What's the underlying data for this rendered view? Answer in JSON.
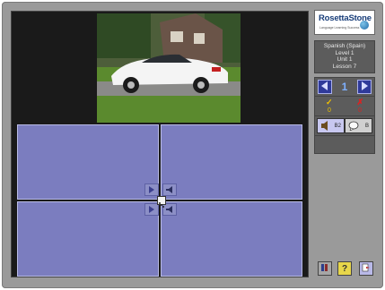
{
  "brand": {
    "name": "RosettaStone",
    "tagline": "Language Learning Success"
  },
  "lesson_info": {
    "language": "Spanish (Spain)",
    "level": "Level 1",
    "unit": "Unit 1",
    "lesson": "Lesson 7"
  },
  "navigation": {
    "current": "1"
  },
  "score": {
    "correct": "0",
    "incorrect": "0"
  },
  "modes": [
    {
      "label": "B2",
      "icon": "speaker-icon",
      "selected": true
    },
    {
      "label": "B",
      "icon": "speech-bubble-icon",
      "selected": false
    }
  ],
  "colors": {
    "answer_panel": "#7b7dbf",
    "nav_button": "#2f3a9a",
    "correct": "#f2c200",
    "incorrect": "#e02020"
  },
  "toolbar": [
    {
      "icon": "settings-icon"
    },
    {
      "icon": "help-icon",
      "label": "?"
    },
    {
      "icon": "exit-icon"
    }
  ]
}
